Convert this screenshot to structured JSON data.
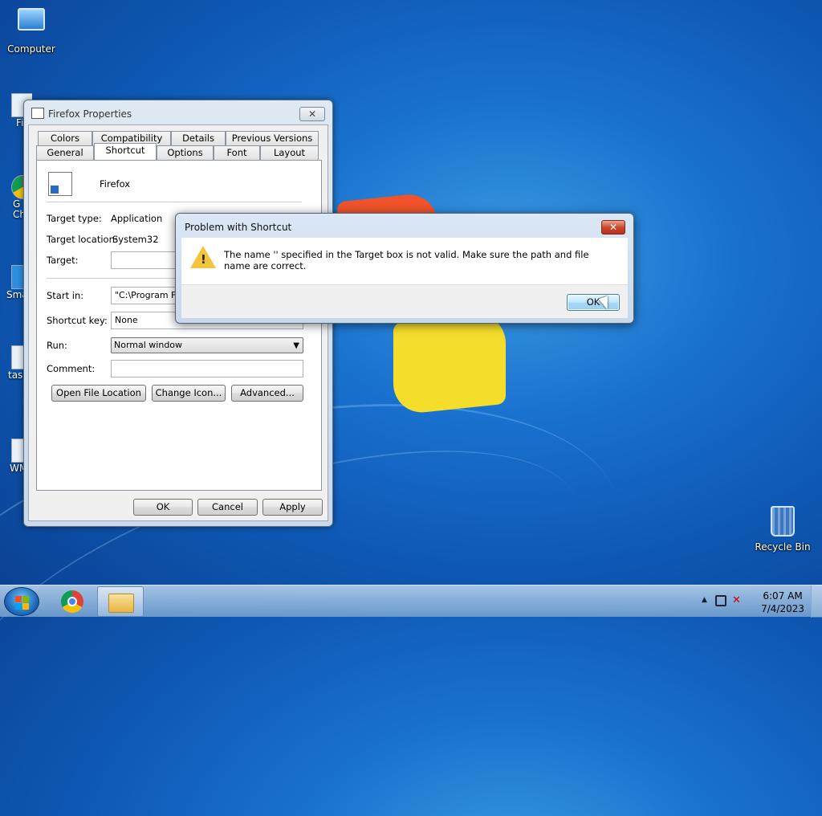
{
  "desktop": {
    "icons": [
      {
        "label": "Computer",
        "icon": "computer-icon"
      },
      {
        "label": "Recycle Bin",
        "icon": "recycle-bin-icon"
      }
    ],
    "partial_icons": [
      "Fi",
      "G\nCh",
      "Sma",
      "task",
      "WM"
    ]
  },
  "properties_window": {
    "title": "Firefox Properties",
    "close_label": "✕",
    "tabs_row1": [
      "Colors",
      "Compatibility",
      "Details",
      "Previous Versions"
    ],
    "tabs_row2": [
      "General",
      "Shortcut",
      "Options",
      "Font",
      "Layout"
    ],
    "selected_tab": "Shortcut",
    "app_name": "Firefox",
    "target_type_label": "Target type:",
    "target_type_value": "Application",
    "target_location_label": "Target location:",
    "target_location_value": "System32",
    "target_label": "Target:",
    "target_value": "",
    "start_in_label": "Start in:",
    "start_in_value": "\"C:\\Program Files",
    "shortcut_key_label": "Shortcut key:",
    "shortcut_key_value": "None",
    "run_label": "Run:",
    "run_value": "Normal window",
    "comment_label": "Comment:",
    "comment_value": "",
    "open_file_location": "Open File Location",
    "change_icon": "Change Icon...",
    "advanced": "Advanced...",
    "ok": "OK",
    "cancel": "Cancel",
    "apply": "Apply"
  },
  "error_dialog": {
    "title": "Problem with Shortcut",
    "close_label": "✕",
    "message": "The name '' specified in the Target box is not valid. Make sure the path and file name are correct.",
    "ok": "OK",
    "icon": "warning-icon"
  },
  "taskbar": {
    "time": "6:07 AM",
    "date": "7/4/2023",
    "pinned": [
      "chrome-icon",
      "file-explorer-icon"
    ]
  }
}
